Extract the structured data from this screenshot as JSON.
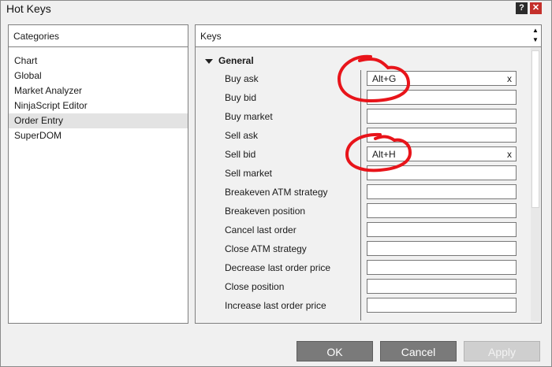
{
  "window": {
    "title": "Hot Keys",
    "help_label": "?",
    "close_label": "✕"
  },
  "categories": {
    "header": "Categories",
    "items": [
      {
        "label": "Chart",
        "selected": false
      },
      {
        "label": "Global",
        "selected": false
      },
      {
        "label": "Market Analyzer",
        "selected": false
      },
      {
        "label": "NinjaScript Editor",
        "selected": false
      },
      {
        "label": "Order Entry",
        "selected": true
      },
      {
        "label": "SuperDOM",
        "selected": false
      }
    ]
  },
  "keys": {
    "header": "Keys",
    "scroll_up": "▲",
    "scroll_down": "▼",
    "group": "General",
    "rows": [
      {
        "name": "Buy ask",
        "value": "Alt+G",
        "clear": "x"
      },
      {
        "name": "Buy bid",
        "value": "",
        "clear": ""
      },
      {
        "name": "Buy market",
        "value": "",
        "clear": ""
      },
      {
        "name": "Sell ask",
        "value": "",
        "clear": ""
      },
      {
        "name": "Sell bid",
        "value": "Alt+H",
        "clear": "x"
      },
      {
        "name": "Sell market",
        "value": "",
        "clear": ""
      },
      {
        "name": "Breakeven ATM strategy",
        "value": "",
        "clear": ""
      },
      {
        "name": "Breakeven position",
        "value": "",
        "clear": ""
      },
      {
        "name": "Cancel last order",
        "value": "",
        "clear": ""
      },
      {
        "name": "Close ATM strategy",
        "value": "",
        "clear": ""
      },
      {
        "name": "Decrease last order price",
        "value": "",
        "clear": ""
      },
      {
        "name": "Close position",
        "value": "",
        "clear": ""
      },
      {
        "name": "Increase last order price",
        "value": "",
        "clear": ""
      }
    ]
  },
  "buttons": {
    "ok": "OK",
    "cancel": "Cancel",
    "apply": "Apply"
  },
  "annotation_color": "#e8141a"
}
